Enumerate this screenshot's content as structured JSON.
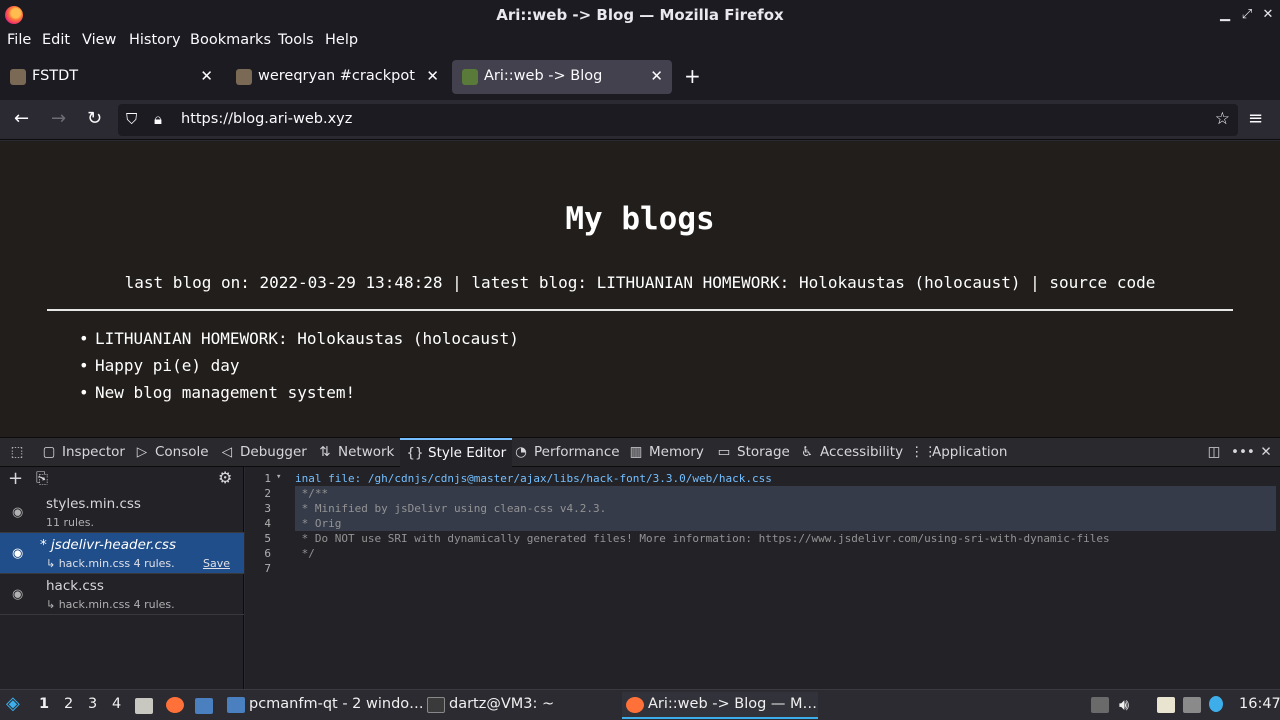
{
  "window": {
    "title": "Ari::web -> Blog — Mozilla Firefox"
  },
  "menu": [
    "File",
    "Edit",
    "View",
    "History",
    "Bookmarks",
    "Tools",
    "Help"
  ],
  "tabs": [
    {
      "label": "FSTDT",
      "active": false
    },
    {
      "label": "wereqryan #crackpot #o",
      "active": false
    },
    {
      "label": "Ari::web -> Blog",
      "active": true
    }
  ],
  "nav": {
    "url": "https://blog.ari-web.xyz"
  },
  "page": {
    "heading": "My blogs",
    "meta": "last blog on: 2022-03-29 13:48:28 | latest blog: LITHUANIAN HOMEWORK: Holokaustas (holocaust) | source code",
    "posts": [
      "LITHUANIAN HOMEWORK: Holokaustas (holocaust)",
      "Happy pi(e) day",
      "New blog management system!"
    ]
  },
  "devtools": {
    "tabs": [
      {
        "label": "Inspector",
        "icon": "inspector-icon"
      },
      {
        "label": "Console",
        "icon": "console-icon"
      },
      {
        "label": "Debugger",
        "icon": "debugger-icon"
      },
      {
        "label": "Network",
        "icon": "network-icon"
      },
      {
        "label": "Style Editor",
        "icon": "style-editor-icon",
        "active": true
      },
      {
        "label": "Performance",
        "icon": "performance-icon"
      },
      {
        "label": "Memory",
        "icon": "memory-icon"
      },
      {
        "label": "Storage",
        "icon": "storage-icon"
      },
      {
        "label": "Accessibility",
        "icon": "accessibility-icon"
      },
      {
        "label": "Application",
        "icon": "application-icon"
      }
    ],
    "sheets": [
      {
        "name": "styles.min.css",
        "sub": "11 rules.",
        "selected": false
      },
      {
        "name": "* jsdelivr-header.css",
        "sub": "↳ hack.min.css  4 rules.",
        "save": "Save",
        "selected": true
      },
      {
        "name": "hack.css",
        "sub": "↳ hack.min.css  4 rules.",
        "selected": false
      }
    ],
    "code": [
      {
        "n": "1",
        "text": "inal file: /gh/cdnjs/cdnjs@master/ajax/libs/hack-font/3.3.0/web/hack.css"
      },
      {
        "n": "2",
        "text": " */**"
      },
      {
        "n": "3",
        "text": " * Minified by jsDelivr using clean-css v4.2.3."
      },
      {
        "n": "4",
        "text": " * Orig"
      },
      {
        "n": "5",
        "text": " * Do NOT use SRI with dynamically generated files! More information: https://www.jsdelivr.com/using-sri-with-dynamic-files"
      },
      {
        "n": "6",
        "text": " */"
      },
      {
        "n": "7",
        "text": ""
      }
    ]
  },
  "taskbar": {
    "workspaces": [
      "1",
      "2",
      "3",
      "4"
    ],
    "tasks": [
      {
        "label": "pcmanfm-qt - 2 windo…"
      },
      {
        "label": "dartz@VM3: ~"
      },
      {
        "label": "Ari::web -> Blog — M…"
      }
    ],
    "clock": "16:47"
  },
  "colors": {
    "accent": "#75bfff",
    "selected_sheet": "#204e8a",
    "page_bg": "#211e1c"
  }
}
